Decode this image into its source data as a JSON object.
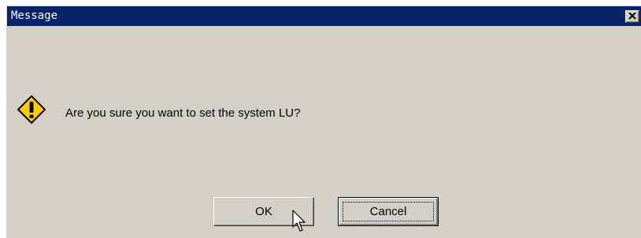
{
  "dialog": {
    "title": "Message",
    "message": "Are you sure you want to set the system LU?",
    "icon": "warning-icon",
    "buttons": {
      "ok_label": "OK",
      "cancel_label": "Cancel"
    }
  },
  "colors": {
    "titlebar": "#0a246a",
    "face": "#d4d0c8",
    "icon_fill": "#ffcc00"
  }
}
